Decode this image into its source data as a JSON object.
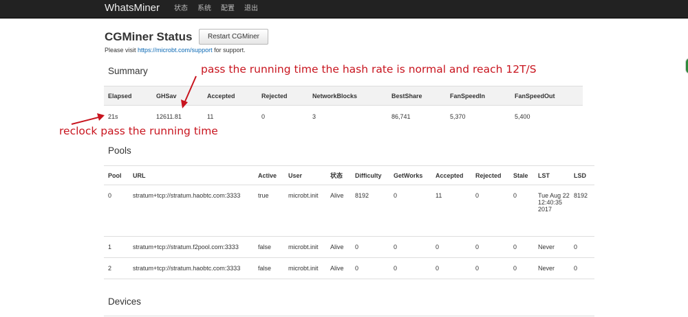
{
  "navbar": {
    "brand": "WhatsMiner",
    "links": [
      "状态",
      "系统",
      "配置",
      "退出"
    ]
  },
  "header": {
    "title": "CGMiner Status",
    "restart_label": "Restart CGMiner",
    "support_prefix": "Please visit ",
    "support_link": "https://microbt.com/support",
    "support_suffix": " for support."
  },
  "summary": {
    "heading": "Summary",
    "columns": [
      "Elapsed",
      "GHSav",
      "Accepted",
      "Rejected",
      "NetworkBlocks",
      "BestShare",
      "FanSpeedIn",
      "FanSpeedOut"
    ],
    "row": [
      "21s",
      "12611.81",
      "11",
      "0",
      "3",
      "86,741",
      "5,370",
      "5,400"
    ]
  },
  "pools": {
    "heading": "Pools",
    "columns": [
      "Pool",
      "URL",
      "Active",
      "User",
      "状态",
      "Difficulty",
      "GetWorks",
      "Accepted",
      "Rejected",
      "Stale",
      "LST",
      "LSD"
    ],
    "rows": [
      [
        "0",
        "stratum+tcp://stratum.haobtc.com:3333",
        "true",
        "microbt.init",
        "Alive",
        "8192",
        "0",
        "11",
        "0",
        "0",
        "Tue Aug 22 12:40:35 2017",
        "8192"
      ],
      [
        "1",
        "stratum+tcp://stratum.f2pool.com:3333",
        "false",
        "microbt.init",
        "Alive",
        "0",
        "0",
        "0",
        "0",
        "0",
        "Never",
        "0"
      ],
      [
        "2",
        "stratum+tcp://stratum.haobtc.com:3333",
        "false",
        "microbt.init",
        "Alive",
        "0",
        "0",
        "0",
        "0",
        "0",
        "Never",
        "0"
      ]
    ]
  },
  "devices": {
    "heading": "Devices"
  },
  "annotations": {
    "top": "pass the running time the hash rate is normal and reach 12T/S",
    "left": "reclock pass the running time",
    "color": "#c8141e"
  }
}
